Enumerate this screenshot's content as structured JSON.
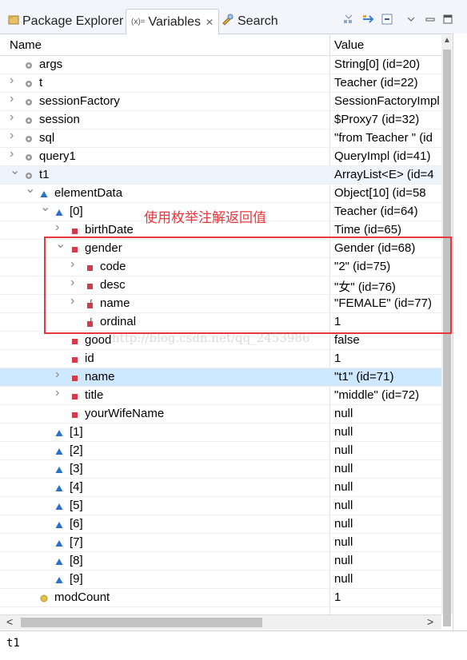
{
  "tabs": [
    {
      "label": "Package Explorer",
      "icon": "package-explorer-icon",
      "active": false
    },
    {
      "label": "Variables",
      "prefix": "(x)=",
      "icon": "variables-icon",
      "active": true,
      "close": "✕"
    },
    {
      "label": "Search",
      "icon": "search-icon",
      "active": false
    }
  ],
  "columns": {
    "name": "Name",
    "value": "Value"
  },
  "rows": [
    {
      "depth": 0,
      "chev": "",
      "icon": "local",
      "name": "args",
      "value": "String[0]  (id=20)"
    },
    {
      "depth": 0,
      "chev": ">",
      "icon": "local",
      "name": "t",
      "value": "Teacher  (id=22)"
    },
    {
      "depth": 0,
      "chev": ">",
      "icon": "local",
      "name": "sessionFactory",
      "value": "SessionFactoryImpl"
    },
    {
      "depth": 0,
      "chev": ">",
      "icon": "local",
      "name": "session",
      "value": "$Proxy7  (id=32)"
    },
    {
      "depth": 0,
      "chev": ">",
      "icon": "local",
      "name": "sql",
      "value": "\"from Teacher \" (id"
    },
    {
      "depth": 0,
      "chev": ">",
      "icon": "local",
      "name": "query1",
      "value": "QueryImpl  (id=41)"
    },
    {
      "depth": 0,
      "chev": "v",
      "icon": "local",
      "name": "t1",
      "value": "ArrayList<E>  (id=4",
      "hl": true
    },
    {
      "depth": 1,
      "chev": "v",
      "icon": "triangle",
      "name": "elementData",
      "value": "Object[10]  (id=58"
    },
    {
      "depth": 2,
      "chev": "v",
      "icon": "triangle",
      "name": "[0]",
      "value": "Teacher  (id=64)"
    },
    {
      "depth": 3,
      "chev": ">",
      "icon": "field",
      "name": "birthDate",
      "value": "Time  (id=65)"
    },
    {
      "depth": 3,
      "chev": "v",
      "icon": "field",
      "name": "gender",
      "value": "Gender  (id=68)"
    },
    {
      "depth": 4,
      "chev": ">",
      "icon": "field",
      "name": "code",
      "value": "\"2\" (id=75)"
    },
    {
      "depth": 4,
      "chev": ">",
      "icon": "field",
      "name": "desc",
      "value": "\"女\" (id=76)"
    },
    {
      "depth": 4,
      "chev": ">",
      "icon": "field-final",
      "name": "name",
      "value": "\"FEMALE\" (id=77)"
    },
    {
      "depth": 4,
      "chev": "",
      "icon": "field-final",
      "name": "ordinal",
      "value": "1"
    },
    {
      "depth": 3,
      "chev": "",
      "icon": "field",
      "name": "good",
      "value": "false"
    },
    {
      "depth": 3,
      "chev": "",
      "icon": "field",
      "name": "id",
      "value": "1"
    },
    {
      "depth": 3,
      "chev": ">",
      "icon": "field",
      "name": "name",
      "value": "\"t1\" (id=71)",
      "sel": true
    },
    {
      "depth": 3,
      "chev": ">",
      "icon": "field",
      "name": "title",
      "value": "\"middle\" (id=72)"
    },
    {
      "depth": 3,
      "chev": "",
      "icon": "field",
      "name": "yourWifeName",
      "value": "null"
    },
    {
      "depth": 2,
      "chev": "",
      "icon": "triangle",
      "name": "[1]",
      "value": "null"
    },
    {
      "depth": 2,
      "chev": "",
      "icon": "triangle",
      "name": "[2]",
      "value": "null"
    },
    {
      "depth": 2,
      "chev": "",
      "icon": "triangle",
      "name": "[3]",
      "value": "null"
    },
    {
      "depth": 2,
      "chev": "",
      "icon": "triangle",
      "name": "[4]",
      "value": "null"
    },
    {
      "depth": 2,
      "chev": "",
      "icon": "triangle",
      "name": "[5]",
      "value": "null"
    },
    {
      "depth": 2,
      "chev": "",
      "icon": "triangle",
      "name": "[6]",
      "value": "null"
    },
    {
      "depth": 2,
      "chev": "",
      "icon": "triangle",
      "name": "[7]",
      "value": "null"
    },
    {
      "depth": 2,
      "chev": "",
      "icon": "triangle",
      "name": "[8]",
      "value": "null"
    },
    {
      "depth": 2,
      "chev": "",
      "icon": "triangle",
      "name": "[9]",
      "value": "null"
    },
    {
      "depth": 1,
      "chev": "",
      "icon": "protected",
      "name": "modCount",
      "value": "1"
    }
  ],
  "detail_text": "t1",
  "annotation": "使用枚举注解返回值",
  "watermark": "http://blog.csdn.net/qq_2453986",
  "colors": {
    "accent": "#e8383d",
    "selection": "#cde8ff",
    "field": "#d33a4a",
    "triangle": "#2a6fc9",
    "local": "#9a9a9a"
  }
}
